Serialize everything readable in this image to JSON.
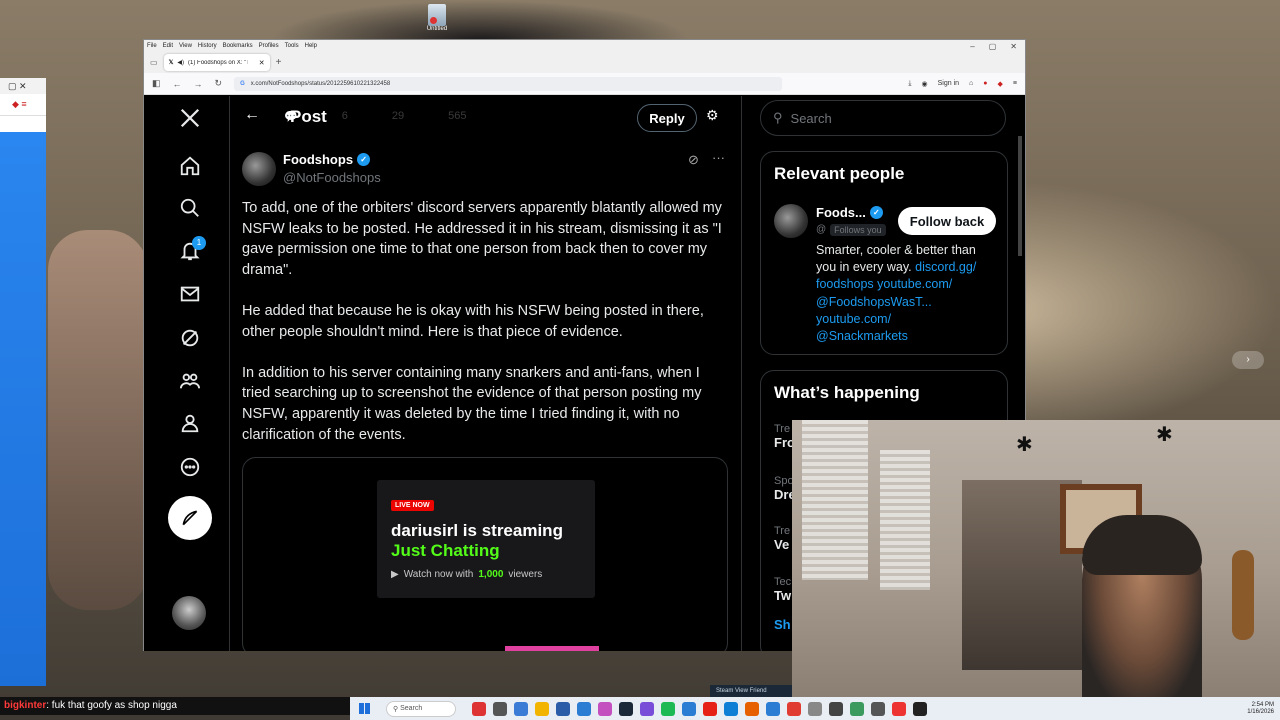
{
  "desktop": {
    "icon_label": "Untitled"
  },
  "browser": {
    "menu": [
      "File",
      "Edit",
      "View",
      "History",
      "Bookmarks",
      "Profiles",
      "Tools",
      "Help"
    ],
    "tab_title": "(1) Foodshops on X: \"To add...",
    "url": "x.com/NotFoodshops/status/2012259610221322458",
    "signin": "Sign in"
  },
  "nav": {
    "notification_count": "1"
  },
  "post_header": {
    "title": "Post",
    "reply_label": "Reply",
    "ghost_stats": [
      "6",
      "29",
      "565"
    ]
  },
  "tweet": {
    "name": "Foodshops",
    "handle": "@NotFoodshops",
    "paragraphs": [
      "To add, one of the orbiters' discord servers apparently blatantly allowed my NSFW leaks to be posted. He addressed it in his stream, dismissing it as \"I gave permission one time to that one person from back then to cover my drama\".",
      "He added that because he is okay with his NSFW being posted in there, other people shouldn't mind. Here is that piece of evidence.",
      "In addition to his server containing many snarkers and anti-fans, when I tried searching up to screenshot the evidence of that person posting my NSFW, apparently it was deleted by the time I tried finding it, with no clarification of the events."
    ]
  },
  "stream_card": {
    "live_label": "LIVE NOW",
    "title_line": "dariusirl is streaming",
    "category": "Just Chatting",
    "watch_prefix": "Watch now with",
    "viewers": "1,000",
    "viewers_suffix": "viewers"
  },
  "right": {
    "search_placeholder": "Search",
    "relevant_title": "Relevant people",
    "person": {
      "name": "Foods...",
      "handle": "@",
      "follows_you": "Follows you",
      "follow_back": "Follow back",
      "bio_text": "Smarter, cooler & better than you in every way.",
      "bio_links": [
        "discord.gg/",
        "foodshops",
        "youtube.com/",
        "@FoodshopsWasT...",
        "youtube.com/",
        "@Snackmarkets"
      ]
    },
    "happening_title": "What’s happening",
    "trend_rows": [
      {
        "meta": "Tre",
        "title": "Fro"
      },
      {
        "meta": "Spo",
        "title": "Dre"
      },
      {
        "meta": "Tre",
        "title": "Ve"
      },
      {
        "meta": "Tec",
        "title": "Tw"
      },
      {
        "meta": "",
        "title": "Sh"
      }
    ]
  },
  "chat": {
    "user": "bigkinter",
    "message": ": fuk that goofy as shop nigga"
  },
  "taskbar": {
    "search": "Search",
    "time": "2:54 PM",
    "date": "1/16/2026",
    "steam": "Steam   View   Friend"
  },
  "colors": {
    "x_blue": "#1d9bf0",
    "kick_green": "#53fc18",
    "live_red": "#eb0400"
  }
}
